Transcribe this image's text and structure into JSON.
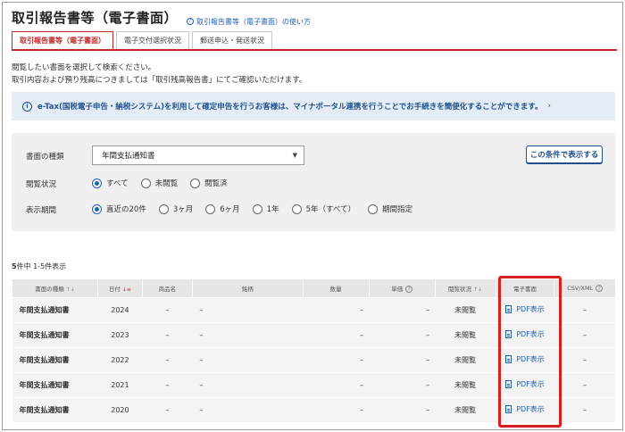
{
  "header": {
    "title": "取引報告書等（電子書面）",
    "help_link": "取引報告書等（電子書面）の使い方"
  },
  "tabs": [
    {
      "label": "取引報告書等（電子書面）",
      "active": true
    },
    {
      "label": "電子交付選択状況",
      "active": false
    },
    {
      "label": "郵送申込・発送状況",
      "active": false
    }
  ],
  "description": {
    "line1": "閲覧したい書面を選択して検索ください。",
    "line2": "取引内容および預り残高につきましては「取引残高報告書」にてご確認いただけます。"
  },
  "notice": {
    "text": "e-Tax(国税電子申告・納税システム)を利用して確定申告を行うお客様は、マイナポータル連携を行うことでお手続きを簡便化することができます。",
    "chevron": "›"
  },
  "search": {
    "doc_type_label": "書面の種類",
    "doc_type_value": "年間支払通知書",
    "read_status_label": "閲覧状況",
    "read_status_options": [
      "すべて",
      "未閲覧",
      "閲覧済"
    ],
    "read_status_selected": "すべて",
    "period_label": "表示期間",
    "period_options": [
      "直近の20件",
      "3ヶ月",
      "6ヶ月",
      "1年",
      "5年（すべて）",
      "期間指定"
    ],
    "period_selected": "直近の20件",
    "submit_label": "この条件で表示する"
  },
  "results": {
    "count_total": "5",
    "count_text": "件中 1-5件表示",
    "columns": {
      "doc_type": "書面の種類",
      "date": "日付",
      "product": "商品名",
      "issue": "銘柄",
      "quantity": "数量",
      "unit_price": "単価",
      "read_status": "閲覧状況",
      "e_document": "電子書面",
      "csv_xml": "CSV/XML"
    },
    "rows": [
      {
        "doc_type": "年間支払通知書",
        "date": "2024",
        "product": "–",
        "issue": "–",
        "quantity": "–",
        "unit_price": "–",
        "read_status": "未閲覧",
        "e_document": "PDF表示",
        "csv_xml": "–"
      },
      {
        "doc_type": "年間支払通知書",
        "date": "2023",
        "product": "–",
        "issue": "–",
        "quantity": "–",
        "unit_price": "–",
        "read_status": "未閲覧",
        "e_document": "PDF表示",
        "csv_xml": "–"
      },
      {
        "doc_type": "年間支払通知書",
        "date": "2022",
        "product": "–",
        "issue": "–",
        "quantity": "–",
        "unit_price": "–",
        "read_status": "未閲覧",
        "e_document": "PDF表示",
        "csv_xml": "–"
      },
      {
        "doc_type": "年間支払通知書",
        "date": "2021",
        "product": "–",
        "issue": "–",
        "quantity": "–",
        "unit_price": "–",
        "read_status": "未閲覧",
        "e_document": "PDF表示",
        "csv_xml": "–"
      },
      {
        "doc_type": "年間支払通知書",
        "date": "2020",
        "product": "–",
        "issue": "–",
        "quantity": "–",
        "unit_price": "–",
        "read_status": "未閲覧",
        "e_document": "PDF表示",
        "csv_xml": "–"
      }
    ]
  },
  "colors": {
    "accent_red": "#c22a2a",
    "link_blue": "#1f5fb4",
    "highlight_red": "#d81f1f"
  }
}
